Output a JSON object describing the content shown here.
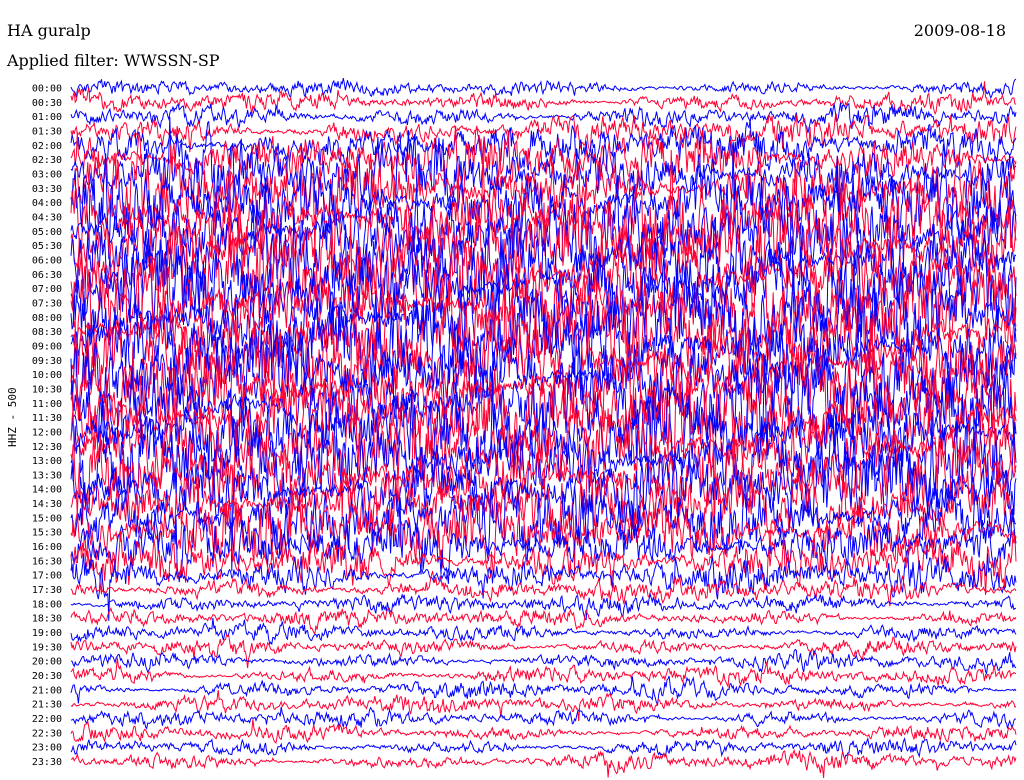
{
  "header": {
    "station": "HA guralp",
    "date": "2009-08-18",
    "filter": "Applied filter: WWSSN-SP"
  },
  "chart_data": {
    "type": "line",
    "title": "HA guralp",
    "subtitle": "Applied filter: WWSSN-SP",
    "date": "2009-08-18",
    "ylabel": "HHZ - 500",
    "xlabel": "",
    "row_times": [
      "00:00",
      "00:30",
      "01:00",
      "01:30",
      "02:00",
      "02:30",
      "03:00",
      "03:30",
      "04:00",
      "04:30",
      "05:00",
      "05:30",
      "06:00",
      "06:30",
      "07:00",
      "07:30",
      "08:00",
      "08:30",
      "09:00",
      "09:30",
      "10:00",
      "10:30",
      "11:00",
      "11:30",
      "12:00",
      "12:30",
      "13:00",
      "13:30",
      "14:00",
      "14:30",
      "15:00",
      "15:30",
      "16:00",
      "16:30",
      "17:00",
      "17:30",
      "18:00",
      "18:30",
      "19:00",
      "19:30",
      "20:00",
      "20:30",
      "21:00",
      "21:30",
      "22:00",
      "22:30",
      "23:00",
      "23:30"
    ],
    "series_colors": [
      "#0000ff",
      "#ff0033"
    ],
    "row_amplitude": [
      0.7,
      0.9,
      1.0,
      1.3,
      1.8,
      2.3,
      2.8,
      3.2,
      3.5,
      3.7,
      3.9,
      4.0,
      4.1,
      4.1,
      4.1,
      4.1,
      4.1,
      4.1,
      4.1,
      4.0,
      4.0,
      4.0,
      3.9,
      3.9,
      3.8,
      3.8,
      3.7,
      3.6,
      3.5,
      3.4,
      3.2,
      3.0,
      2.6,
      2.2,
      1.6,
      1.0,
      0.8,
      0.75,
      0.75,
      0.75,
      0.75,
      0.75,
      0.75,
      0.75,
      0.7,
      0.7,
      0.7,
      0.75
    ],
    "grid": false
  }
}
